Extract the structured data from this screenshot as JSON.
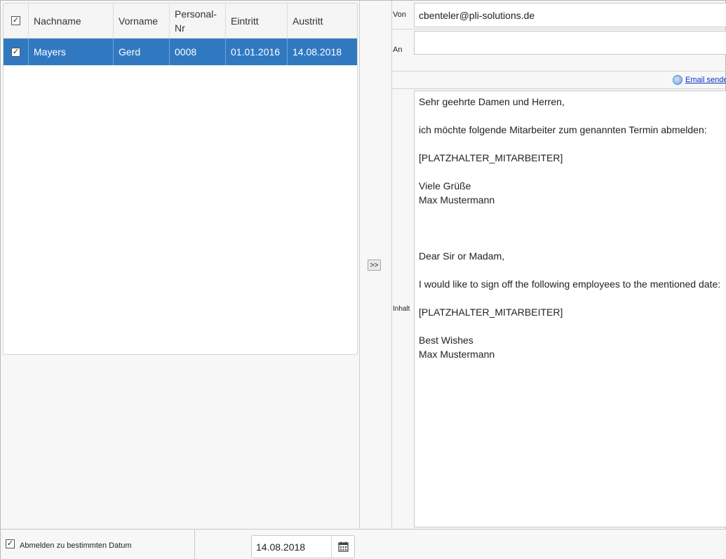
{
  "table": {
    "headers": {
      "select_all_checked": "✓",
      "nachname": "Nachname",
      "vorname": "Vorname",
      "personal_nr": "Personal-Nr",
      "eintritt": "Eintritt",
      "austritt": "Austritt"
    },
    "rows": [
      {
        "checked": "✓",
        "nachname": "Mayers",
        "vorname": "Gerd",
        "personal_nr": "0008",
        "eintritt": "01.01.2016",
        "austritt": "14.08.2018"
      }
    ]
  },
  "transfer_button": {
    "label": ">>"
  },
  "email": {
    "von_label": "Von",
    "von_value": "cbenteler@pli-solutions.de",
    "an_label": "An",
    "an_value": "",
    "send_link": "Email senden",
    "inhalt_label": "Inhalt",
    "body_lines": [
      "Sehr geehrte Damen und Herren,",
      "",
      "ich möchte folgende Mitarbeiter zum genannten Termin abmelden:",
      "",
      "[PLATZHALTER_MITARBEITER]",
      "",
      "Viele Grüße",
      "Max Mustermann",
      "",
      "",
      "",
      "Dear Sir or Madam,",
      "",
      "I would like to sign off the following employees to the mentioned date:",
      "",
      "[PLATZHALTER_MITARBEITER]",
      "",
      "Best Wishes",
      "Max Mustermann"
    ]
  },
  "footer": {
    "checkbox_checked": "✓",
    "checkbox_label": "Abmelden zu bestimmten Datum",
    "date_value": "14.08.2018"
  }
}
